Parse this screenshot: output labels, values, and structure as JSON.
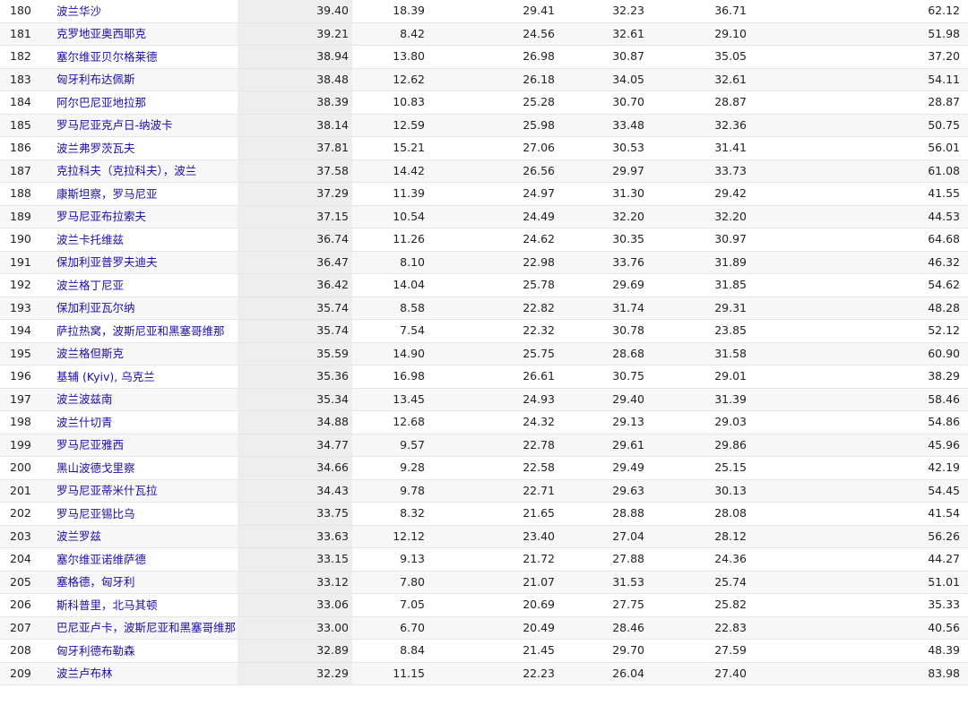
{
  "table": {
    "rows": [
      {
        "rank": "180",
        "city": "波兰华沙",
        "qol_index": "39.40",
        "rent_index": "18.39",
        "groceries_index": "29.41",
        "restaurant_index": "32.23",
        "purchasing_index": "36.71",
        "last_index": "62.12"
      },
      {
        "rank": "181",
        "city": "克罗地亚奥西耶克",
        "qol_index": "39.21",
        "rent_index": "8.42",
        "groceries_index": "24.56",
        "restaurant_index": "32.61",
        "purchasing_index": "29.10",
        "last_index": "51.98"
      },
      {
        "rank": "182",
        "city": "塞尔维亚贝尔格莱德",
        "qol_index": "38.94",
        "rent_index": "13.80",
        "groceries_index": "26.98",
        "restaurant_index": "30.87",
        "purchasing_index": "35.05",
        "last_index": "37.20"
      },
      {
        "rank": "183",
        "city": "匈牙利布达佩斯",
        "qol_index": "38.48",
        "rent_index": "12.62",
        "groceries_index": "26.18",
        "restaurant_index": "34.05",
        "purchasing_index": "32.61",
        "last_index": "54.11"
      },
      {
        "rank": "184",
        "city": "阿尔巴尼亚地拉那",
        "qol_index": "38.39",
        "rent_index": "10.83",
        "groceries_index": "25.28",
        "restaurant_index": "30.70",
        "purchasing_index": "28.87",
        "last_index": "28.87"
      },
      {
        "rank": "185",
        "city": "罗马尼亚克卢日-纳波卡",
        "qol_index": "38.14",
        "rent_index": "12.59",
        "groceries_index": "25.98",
        "restaurant_index": "33.48",
        "purchasing_index": "32.36",
        "last_index": "50.75"
      },
      {
        "rank": "186",
        "city": "波兰弗罗茨瓦夫",
        "qol_index": "37.81",
        "rent_index": "15.21",
        "groceries_index": "27.06",
        "restaurant_index": "30.53",
        "purchasing_index": "31.41",
        "last_index": "56.01"
      },
      {
        "rank": "187",
        "city": "克拉科夫（克拉科夫），波兰",
        "qol_index": "37.58",
        "rent_index": "14.42",
        "groceries_index": "26.56",
        "restaurant_index": "29.97",
        "purchasing_index": "33.73",
        "last_index": "61.08"
      },
      {
        "rank": "188",
        "city": "康斯坦察，罗马尼亚",
        "qol_index": "37.29",
        "rent_index": "11.39",
        "groceries_index": "24.97",
        "restaurant_index": "31.30",
        "purchasing_index": "29.42",
        "last_index": "41.55"
      },
      {
        "rank": "189",
        "city": "罗马尼亚布拉索夫",
        "qol_index": "37.15",
        "rent_index": "10.54",
        "groceries_index": "24.49",
        "restaurant_index": "32.20",
        "purchasing_index": "32.20",
        "last_index": "44.53"
      },
      {
        "rank": "190",
        "city": "波兰卡托维兹",
        "qol_index": "36.74",
        "rent_index": "11.26",
        "groceries_index": "24.62",
        "restaurant_index": "30.35",
        "purchasing_index": "30.97",
        "last_index": "64.68"
      },
      {
        "rank": "191",
        "city": "保加利亚普罗夫迪夫",
        "qol_index": "36.47",
        "rent_index": "8.10",
        "groceries_index": "22.98",
        "restaurant_index": "33.76",
        "purchasing_index": "31.89",
        "last_index": "46.32"
      },
      {
        "rank": "192",
        "city": "波兰格丁尼亚",
        "qol_index": "36.42",
        "rent_index": "14.04",
        "groceries_index": "25.78",
        "restaurant_index": "29.69",
        "purchasing_index": "31.85",
        "last_index": "54.62"
      },
      {
        "rank": "193",
        "city": "保加利亚瓦尔纳",
        "qol_index": "35.74",
        "rent_index": "8.58",
        "groceries_index": "22.82",
        "restaurant_index": "31.74",
        "purchasing_index": "29.31",
        "last_index": "48.28"
      },
      {
        "rank": "194",
        "city": "萨拉热窝，波斯尼亚和黑塞哥维那",
        "qol_index": "35.74",
        "rent_index": "7.54",
        "groceries_index": "22.32",
        "restaurant_index": "30.78",
        "purchasing_index": "23.85",
        "last_index": "52.12"
      },
      {
        "rank": "195",
        "city": "波兰格但斯克",
        "qol_index": "35.59",
        "rent_index": "14.90",
        "groceries_index": "25.75",
        "restaurant_index": "28.68",
        "purchasing_index": "31.58",
        "last_index": "60.90"
      },
      {
        "rank": "196",
        "city": "基辅 (Kyiv), 乌克兰",
        "qol_index": "35.36",
        "rent_index": "16.98",
        "groceries_index": "26.61",
        "restaurant_index": "30.75",
        "purchasing_index": "29.01",
        "last_index": "38.29"
      },
      {
        "rank": "197",
        "city": "波兰波兹南",
        "qol_index": "35.34",
        "rent_index": "13.45",
        "groceries_index": "24.93",
        "restaurant_index": "29.40",
        "purchasing_index": "31.39",
        "last_index": "58.46"
      },
      {
        "rank": "198",
        "city": "波兰什切青",
        "qol_index": "34.88",
        "rent_index": "12.68",
        "groceries_index": "24.32",
        "restaurant_index": "29.13",
        "purchasing_index": "29.03",
        "last_index": "54.86"
      },
      {
        "rank": "199",
        "city": "罗马尼亚雅西",
        "qol_index": "34.77",
        "rent_index": "9.57",
        "groceries_index": "22.78",
        "restaurant_index": "29.61",
        "purchasing_index": "29.86",
        "last_index": "45.96"
      },
      {
        "rank": "200",
        "city": "黑山波德戈里察",
        "qol_index": "34.66",
        "rent_index": "9.28",
        "groceries_index": "22.58",
        "restaurant_index": "29.49",
        "purchasing_index": "25.15",
        "last_index": "42.19"
      },
      {
        "rank": "201",
        "city": "罗马尼亚蒂米什瓦拉",
        "qol_index": "34.43",
        "rent_index": "9.78",
        "groceries_index": "22.71",
        "restaurant_index": "29.63",
        "purchasing_index": "30.13",
        "last_index": "54.45"
      },
      {
        "rank": "202",
        "city": "罗马尼亚锡比乌",
        "qol_index": "33.75",
        "rent_index": "8.32",
        "groceries_index": "21.65",
        "restaurant_index": "28.88",
        "purchasing_index": "28.08",
        "last_index": "41.54"
      },
      {
        "rank": "203",
        "city": "波兰罗兹",
        "qol_index": "33.63",
        "rent_index": "12.12",
        "groceries_index": "23.40",
        "restaurant_index": "27.04",
        "purchasing_index": "28.12",
        "last_index": "56.26"
      },
      {
        "rank": "204",
        "city": "塞尔维亚诺维萨德",
        "qol_index": "33.15",
        "rent_index": "9.13",
        "groceries_index": "21.72",
        "restaurant_index": "27.88",
        "purchasing_index": "24.36",
        "last_index": "44.27"
      },
      {
        "rank": "205",
        "city": "塞格德，匈牙利",
        "qol_index": "33.12",
        "rent_index": "7.80",
        "groceries_index": "21.07",
        "restaurant_index": "31.53",
        "purchasing_index": "25.74",
        "last_index": "51.01"
      },
      {
        "rank": "206",
        "city": "斯科普里，北马其顿",
        "qol_index": "33.06",
        "rent_index": "7.05",
        "groceries_index": "20.69",
        "restaurant_index": "27.75",
        "purchasing_index": "25.82",
        "last_index": "35.33"
      },
      {
        "rank": "207",
        "city": "巴尼亚卢卡，波斯尼亚和黑塞哥维那",
        "qol_index": "33.00",
        "rent_index": "6.70",
        "groceries_index": "20.49",
        "restaurant_index": "28.46",
        "purchasing_index": "22.83",
        "last_index": "40.56"
      },
      {
        "rank": "208",
        "city": "匈牙利德布勒森",
        "qol_index": "32.89",
        "rent_index": "8.84",
        "groceries_index": "21.45",
        "restaurant_index": "29.70",
        "purchasing_index": "27.59",
        "last_index": "48.39"
      },
      {
        "rank": "209",
        "city": "波兰卢布林",
        "qol_index": "32.29",
        "rent_index": "11.15",
        "groceries_index": "22.23",
        "restaurant_index": "26.04",
        "purchasing_index": "27.40",
        "last_index": "83.98"
      }
    ]
  }
}
